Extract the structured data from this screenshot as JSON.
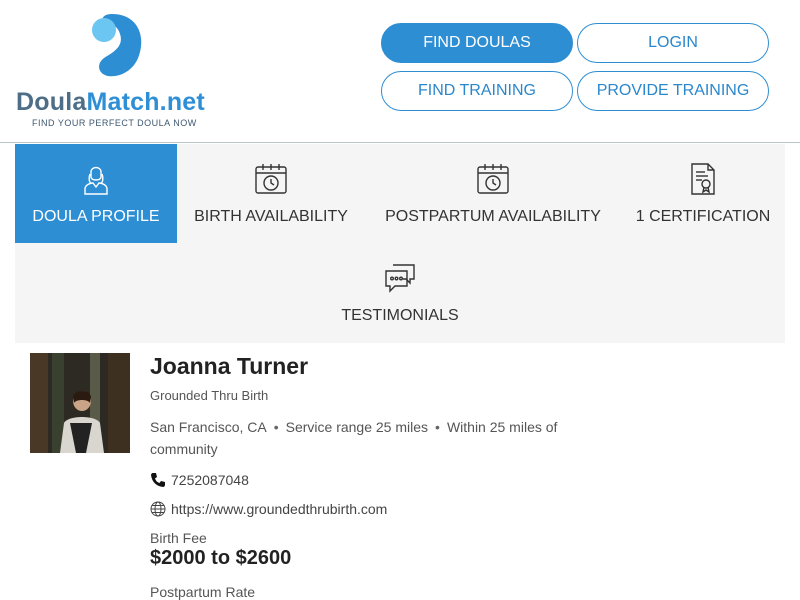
{
  "brand": {
    "name_part1": "Doula",
    "name_part2": "Match.net",
    "tagline": "FIND YOUR PERFECT DOULA NOW",
    "colors": {
      "primary": "#2e8ed4",
      "dark_blue": "#4d6e86",
      "light_blue": "#5cc2f0"
    }
  },
  "header": {
    "buttons": [
      {
        "label": "FIND DOULAS",
        "active": true
      },
      {
        "label": "LOGIN",
        "active": false
      },
      {
        "label": "FIND TRAINING",
        "active": false
      },
      {
        "label": "PROVIDE TRAINING",
        "active": false
      }
    ]
  },
  "tabs": [
    {
      "label": "DOULA PROFILE",
      "icon": "doula-person-icon",
      "active": true
    },
    {
      "label": "BIRTH AVAILABILITY",
      "icon": "calendar-clock-icon",
      "active": false
    },
    {
      "label": "POSTPARTUM AVAILABILITY",
      "icon": "calendar-clock-icon",
      "active": false
    },
    {
      "label": "1 CERTIFICATION",
      "icon": "certificate-icon",
      "active": false
    },
    {
      "label": "TESTIMONIALS",
      "icon": "chat-bubbles-icon",
      "active": false
    }
  ],
  "profile": {
    "name": "Joanna Turner",
    "organization": "Grounded Thru Birth",
    "location": "San Francisco, CA",
    "service_range": "Service range 25 miles",
    "community": "Within 25 miles of community",
    "phone": "7252087048",
    "website": "https://www.groundedthrubirth.com",
    "birth_fee_label": "Birth Fee",
    "birth_fee_value": "$2000 to $2600",
    "postpartum_label": "Postpartum Rate"
  }
}
